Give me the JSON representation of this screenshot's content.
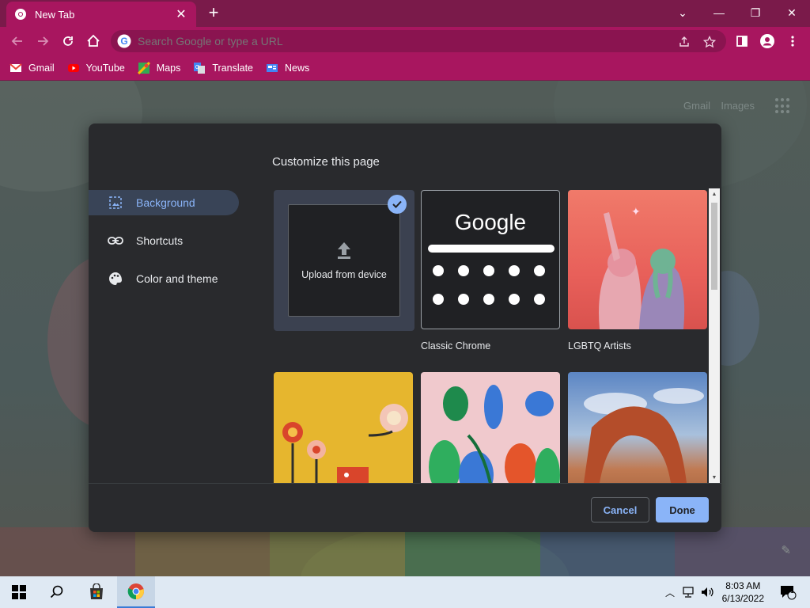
{
  "browser": {
    "tab_title": "New Tab",
    "omnibox_placeholder": "Search Google or type a URL",
    "bookmarks": [
      {
        "label": "Gmail",
        "icon": "gmail-icon",
        "color": "#ea4335"
      },
      {
        "label": "YouTube",
        "icon": "youtube-icon",
        "color": "#ff0000"
      },
      {
        "label": "Maps",
        "icon": "maps-icon",
        "color": "#34a853"
      },
      {
        "label": "Translate",
        "icon": "translate-icon",
        "color": "#4285f4"
      },
      {
        "label": "News",
        "icon": "news-icon",
        "color": "#4285f4"
      }
    ]
  },
  "ntp": {
    "gmail_link": "Gmail",
    "images_link": "Images"
  },
  "dialog": {
    "title": "Customize this page",
    "nav": [
      {
        "label": "Background",
        "icon": "image-icon",
        "active": true
      },
      {
        "label": "Shortcuts",
        "icon": "link-icon",
        "active": false
      },
      {
        "label": "Color and theme",
        "icon": "palette-icon",
        "active": false
      }
    ],
    "upload_label": "Upload from device",
    "classic_logo": "Google",
    "tiles": [
      {
        "label": "Classic Chrome"
      },
      {
        "label": "LGBTQ Artists"
      }
    ],
    "cancel_label": "Cancel",
    "done_label": "Done"
  },
  "taskbar": {
    "time": "8:03 AM",
    "date": "6/13/2022",
    "notification_count": "1"
  },
  "colors": {
    "theme": "#a8165f",
    "accent": "#8ab4f8",
    "dialog_bg": "#292a2d"
  }
}
